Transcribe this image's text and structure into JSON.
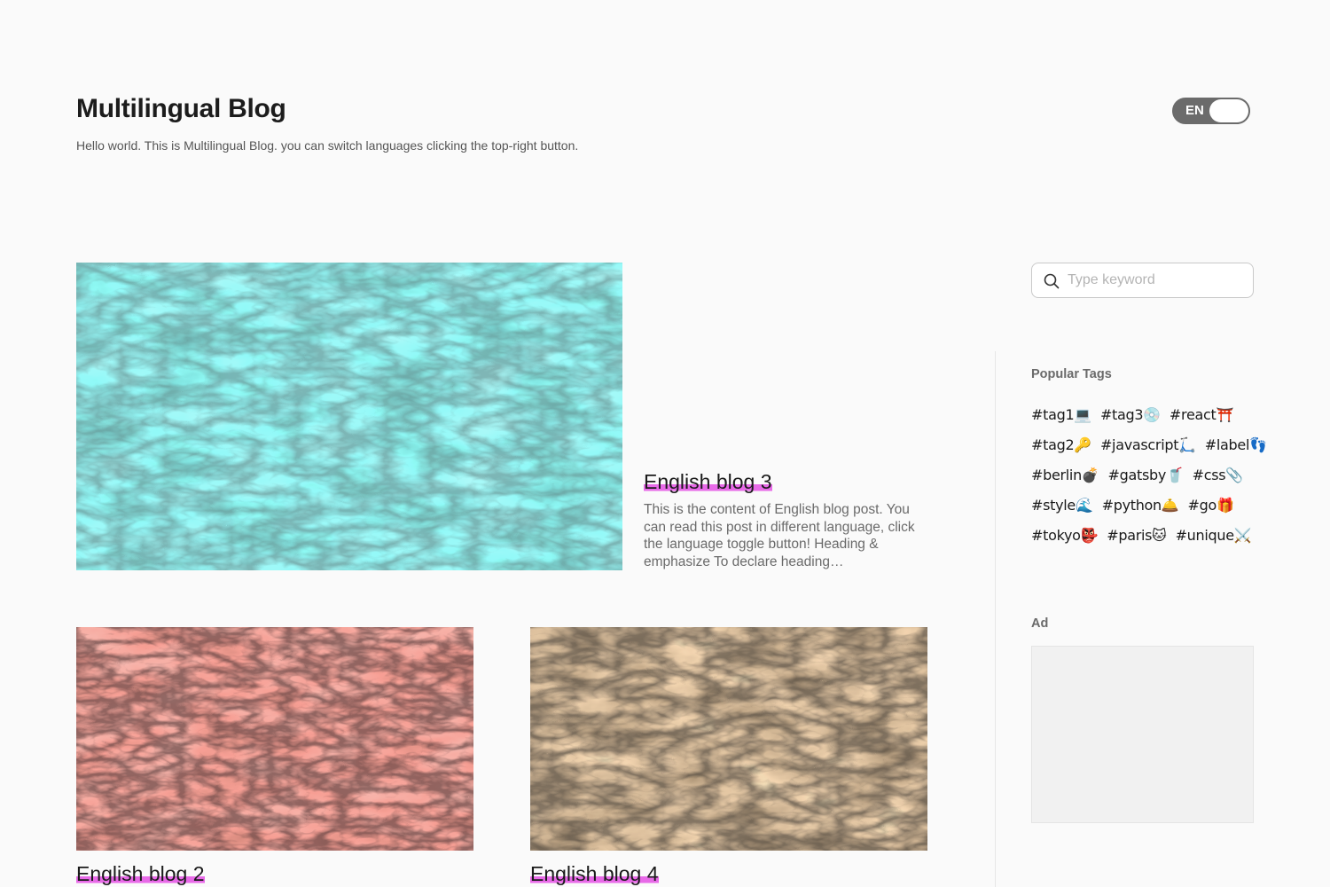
{
  "header": {
    "title": "Multilingual Blog",
    "description": "Hello world. This is Multilingual Blog. you can switch languages clicking the top-right button.",
    "language_toggle": "EN"
  },
  "posts": {
    "featured": {
      "title": "English blog 3",
      "excerpt": "This is the content of English blog post. You can read this post in different language, click the language toggle button! Heading & emphasize To declare heading…"
    },
    "cards": [
      {
        "title": "English blog 2"
      },
      {
        "title": "English blog 4"
      }
    ]
  },
  "sidebar": {
    "search_placeholder": "Type keyword",
    "popular_tags_heading": "Popular Tags",
    "tag_rows": [
      [
        "#tag1💻",
        "#tag3💿",
        "#react⛩️"
      ],
      [
        "#tag2🔑",
        "#javascript🛴",
        "#label👣"
      ],
      [
        "#berlin💣",
        "#gatsby🥤",
        "#css📎"
      ],
      [
        "#style🌊",
        "#python🛎️",
        "#go🎁"
      ],
      [
        "#tokyo👺",
        "#paris🐱",
        "#unique⚔️"
      ]
    ],
    "ad_heading": "Ad"
  },
  "colors": {
    "accent_highlight": "#e86ae8",
    "toggle": "#6b6b6b",
    "background": "#fafafa"
  }
}
